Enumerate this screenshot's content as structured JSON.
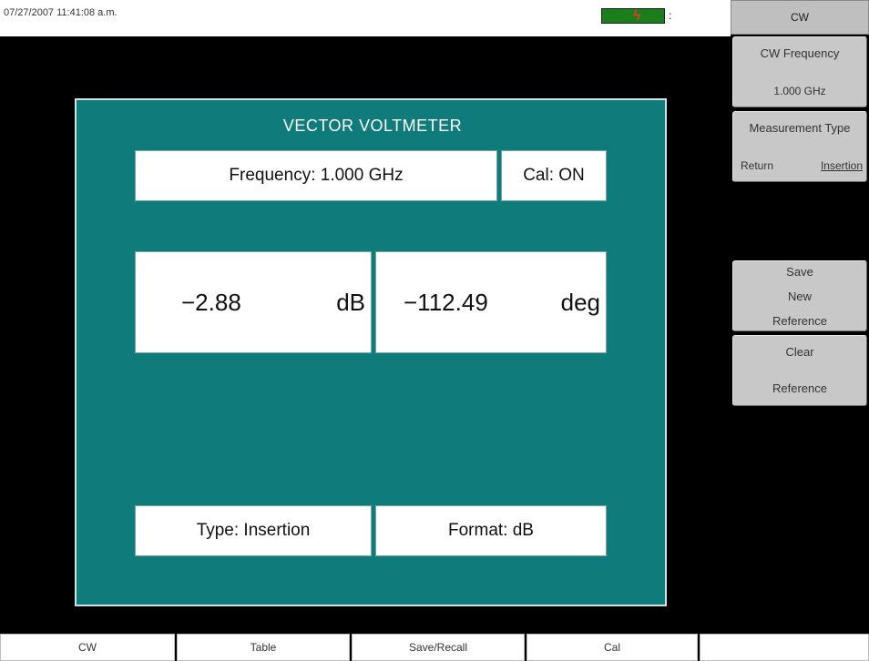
{
  "status_bar": {
    "timestamp": "07/27/2007 11:41:08 a.m.",
    "battery_icon": "battery-charging-icon",
    "battery_color": "#1a7f1a",
    "bolt_glyph": "ϟ",
    "tip_glyph": ":"
  },
  "panel": {
    "title": "VECTOR VOLTMETER",
    "frequency": "Frequency: 1.000 GHz",
    "cal": "Cal: ON",
    "magnitude_value": "−2.88",
    "magnitude_unit": "dB",
    "phase_value": "−112.49",
    "phase_unit": "deg",
    "type": "Type: Insertion",
    "format": "Format: dB",
    "background_color": "#0f7b7b"
  },
  "menu": {
    "title": "CW",
    "cw_frequency": {
      "label": "CW Frequency",
      "value": "1.000 GHz"
    },
    "measurement_type": {
      "label": "Measurement Type",
      "option_return": "Return",
      "option_insertion": "Insertion",
      "selected": "Insertion"
    },
    "save_reference": {
      "line1": "Save",
      "line2": "New",
      "line3": "Reference"
    },
    "clear_reference": {
      "line1": "Clear",
      "line2": "Reference"
    }
  },
  "tabs": [
    "CW",
    "Table",
    "Save/Recall",
    "Cal",
    ""
  ]
}
